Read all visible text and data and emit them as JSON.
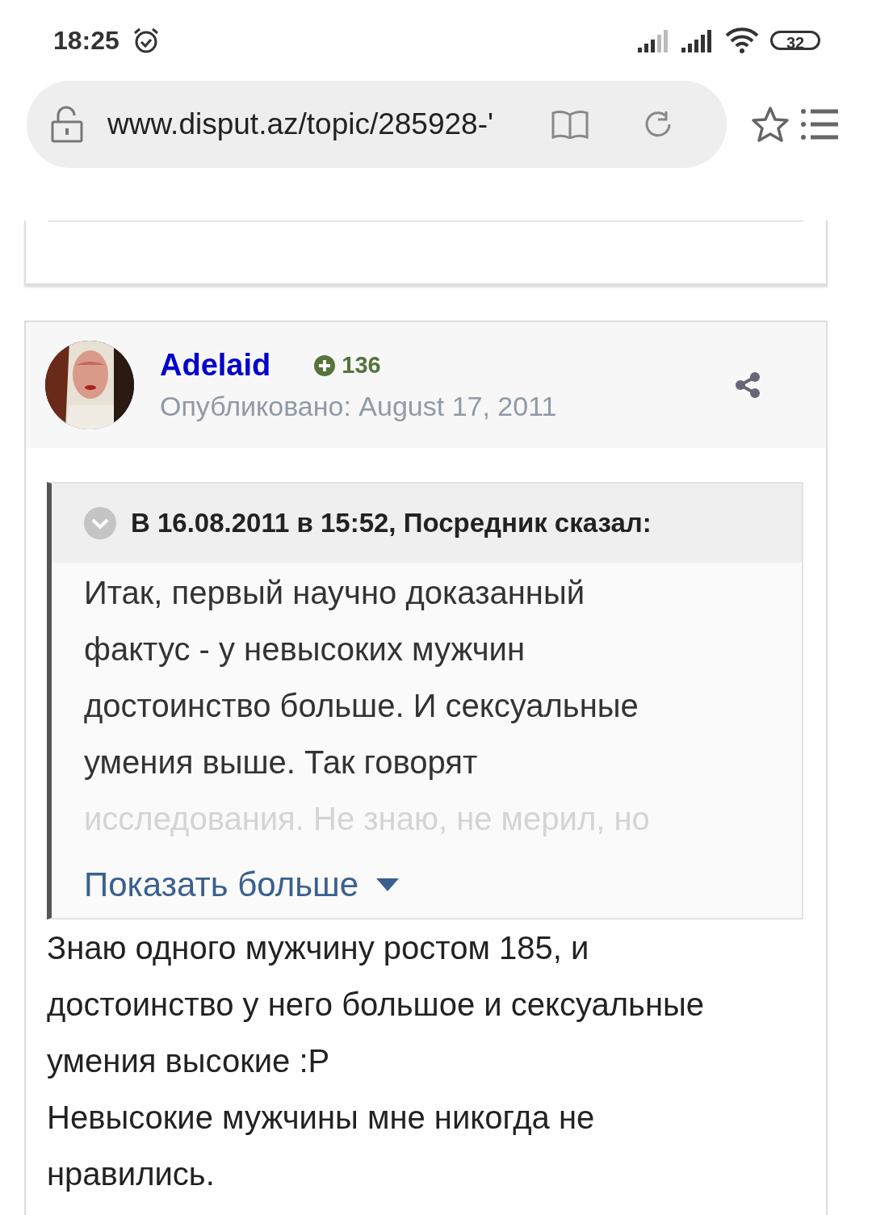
{
  "status_bar": {
    "time": "18:25",
    "battery": "32"
  },
  "address_bar": {
    "url": "www.disput.az/topic/285928-'"
  },
  "post": {
    "author": "Adelaid",
    "reputation": "136",
    "published": "Опубликовано: August 17, 2011",
    "quote": {
      "header": "В 16.08.2011 в 15:52, Посредник сказал:",
      "lines": [
        "Итак, первый научно доказанный",
        "фактус - у невысоких мужчин",
        "достоинство больше. И сексуальные",
        "умения выше. Так говорят",
        "исследования. Не знаю, не мерил, но"
      ],
      "show_more": "Показать больше"
    },
    "body": [
      "Знаю одного мужчину ростом 185, и достоинство у него большое и сексуальные умения высокие :P",
      "Невысокие мужчины мне никогда не нравились."
    ]
  }
}
